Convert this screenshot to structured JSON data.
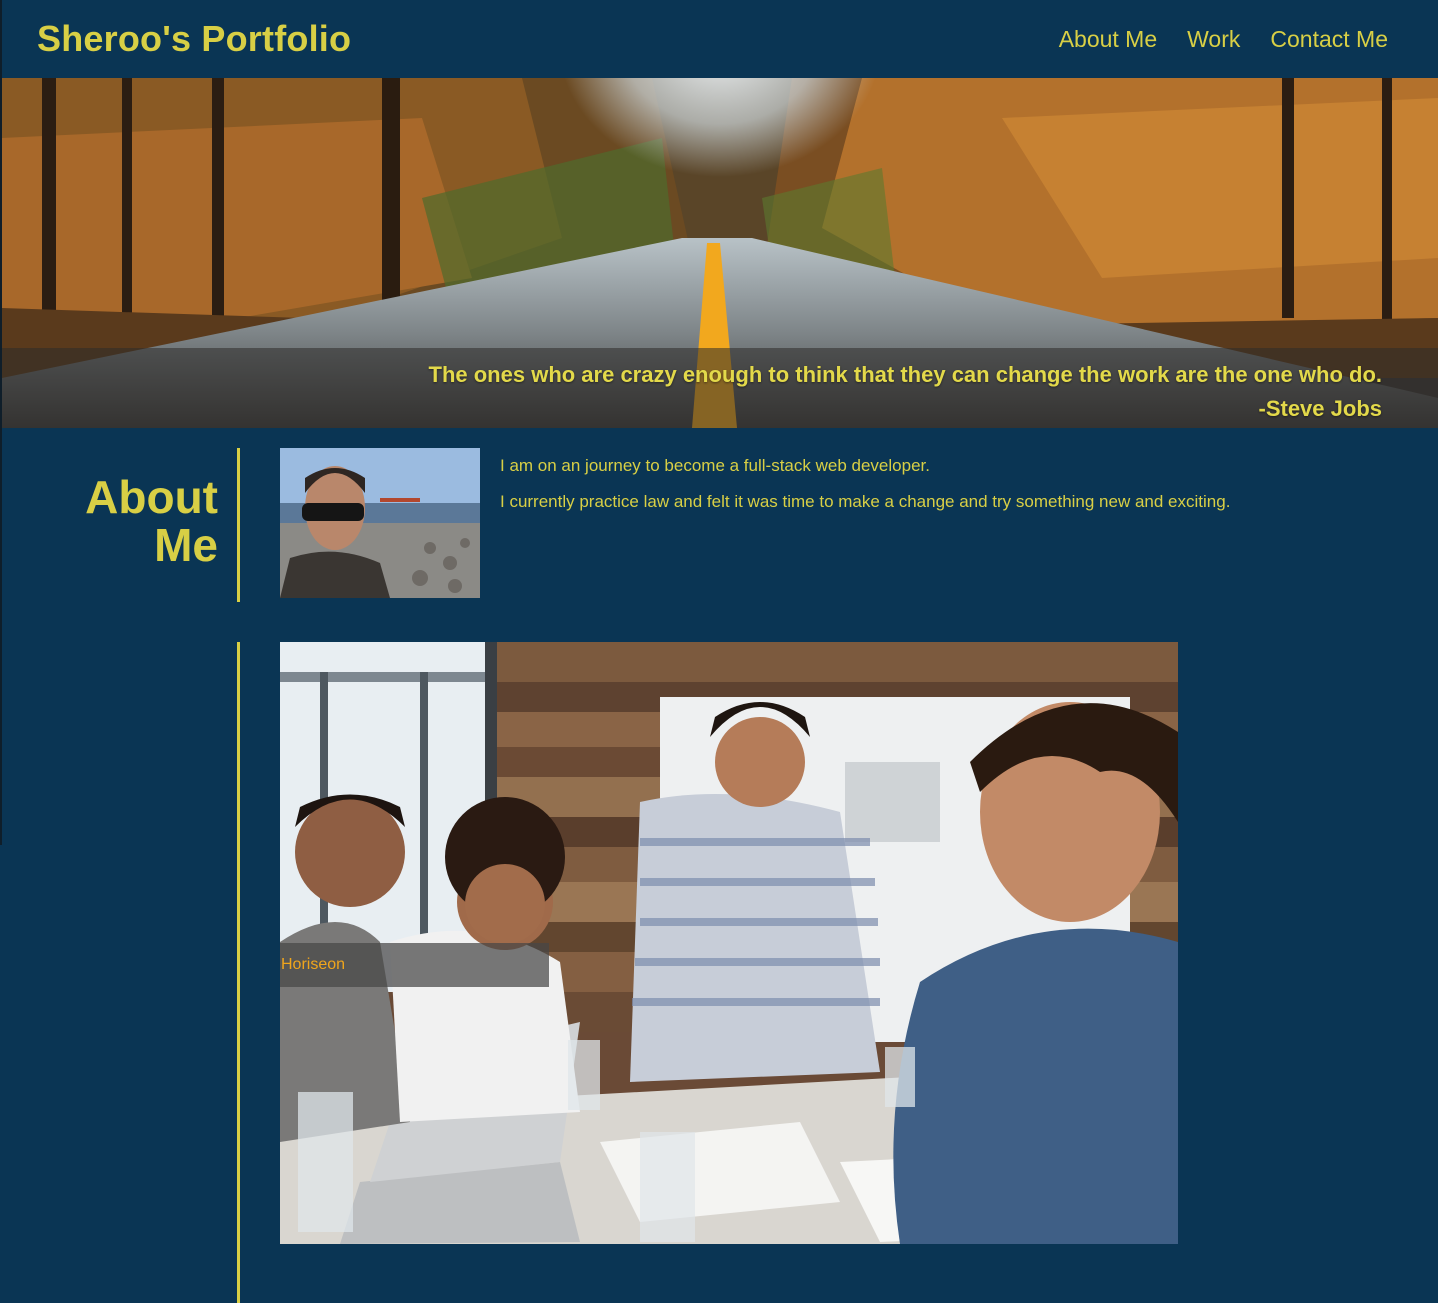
{
  "header": {
    "brand": "Sheroo's Portfolio",
    "nav": [
      {
        "label": "About Me"
      },
      {
        "label": "Work"
      },
      {
        "label": "Contact Me"
      }
    ]
  },
  "hero": {
    "quote": "The ones who are crazy enough to think that they can change the work are the one who do.",
    "author": "-Steve Jobs"
  },
  "about": {
    "heading_line1": "About",
    "heading_line2": "Me",
    "paragraphs": [
      "I am on an journey to become a full-stack web developer.",
      "I currently practice law and felt it was time to make a change and try something new and exciting."
    ]
  },
  "work": {
    "items": [
      {
        "label": "Horiseon"
      }
    ]
  },
  "colors": {
    "background": "#0a3554",
    "accent": "#d8cf45",
    "work_label": "#f0a51c"
  }
}
